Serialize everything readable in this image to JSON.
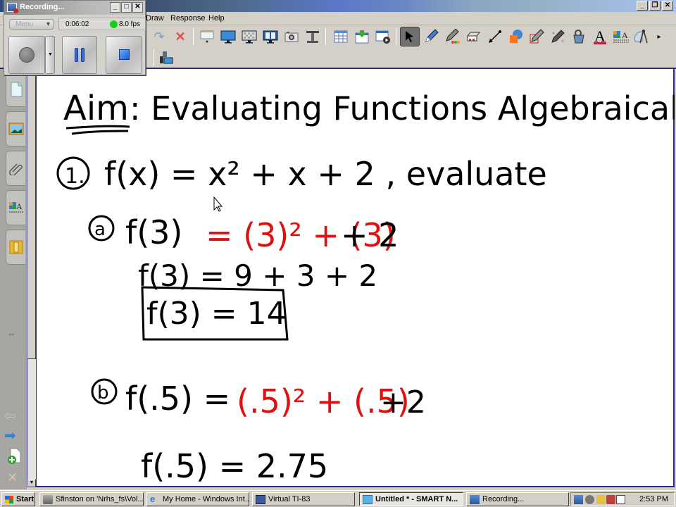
{
  "window": {
    "title_bar_controls": [
      "minimize",
      "restore",
      "close"
    ]
  },
  "menubar": {
    "items": [
      "Draw",
      "Response",
      "Help"
    ]
  },
  "toolbar": {
    "row1": [
      {
        "name": "redo-icon",
        "glyph": "↷"
      },
      {
        "name": "delete-icon",
        "glyph": "✕"
      },
      {
        "name": "screen-shade-icon",
        "glyph": "▭"
      },
      {
        "name": "full-screen-icon",
        "glyph": "🖵"
      },
      {
        "name": "transparent-background-icon",
        "glyph": "▦"
      },
      {
        "name": "dual-page-display-icon",
        "glyph": "▥"
      },
      {
        "name": "screen-capture-icon",
        "glyph": "📷"
      },
      {
        "name": "document-camera-icon",
        "glyph": "⊤"
      },
      {
        "name": "insert-table-icon",
        "glyph": "▤"
      },
      {
        "name": "insert-question-icon",
        "glyph": "⬇"
      },
      {
        "name": "start-assessment-icon",
        "glyph": "▶"
      },
      {
        "name": "select-arrow-icon",
        "glyph": "➤"
      },
      {
        "name": "pen-icon",
        "glyph": "✎"
      },
      {
        "name": "creative-pen-icon",
        "glyph": "✎"
      },
      {
        "name": "eraser-icon",
        "glyph": "▬"
      },
      {
        "name": "line-icon",
        "glyph": "╱"
      },
      {
        "name": "shapes-icon",
        "glyph": "◧"
      },
      {
        "name": "shape-recognition-pen-icon",
        "glyph": "✎"
      },
      {
        "name": "magic-pen-icon",
        "glyph": "✎"
      },
      {
        "name": "fill-icon",
        "glyph": "⛾"
      },
      {
        "name": "text-icon",
        "glyph": "A"
      },
      {
        "name": "properties-icon",
        "glyph": "A"
      },
      {
        "name": "measurement-tools-icon",
        "glyph": "⚖"
      },
      {
        "name": "more-tools-icon",
        "glyph": "▸"
      }
    ],
    "row2": [
      {
        "name": "customize-toolbar-icon",
        "glyph": "⚙"
      }
    ]
  },
  "recorder": {
    "title": "Recording...",
    "menu_label": "Menu",
    "elapsed": "0:06:02",
    "fps": "8.0 fps",
    "status_color": "#18d018",
    "buttons": [
      "record",
      "record-options",
      "pause",
      "stop"
    ]
  },
  "sidebar": {
    "tabs": [
      {
        "name": "page-sorter-tab",
        "label": "Page Sorter"
      },
      {
        "name": "gallery-tab",
        "label": "Gallery"
      },
      {
        "name": "attachments-tab",
        "label": "Attachments"
      },
      {
        "name": "properties-tab",
        "label": "Properties"
      },
      {
        "name": "add-ons-tab",
        "label": "Add-ons"
      }
    ],
    "bottom_controls": [
      "move-sidebar",
      "previous-page",
      "next-page",
      "add-page",
      "delete-page"
    ]
  },
  "notebook": {
    "title_line": {
      "prefix": "Aim",
      "text": ": Evaluating Functions Algebraically"
    },
    "problem": {
      "number": "1.",
      "expression": "f(x) = x² + x + 2 , evaluate"
    },
    "part_a": {
      "label": "a",
      "line1_black": "f(3)",
      "line1_red": "= (3)² + (3)",
      "line1_tail": "+ 2",
      "line2": "f(3) = 9 + 3 + 2",
      "answer": "f(3) = 14"
    },
    "part_b": {
      "label": "b",
      "line1_black": "f(.5) =",
      "line1_red": "(.5)² + (.5)",
      "line1_tail": "+2",
      "line2": "f(.5) = 2.75"
    },
    "ink_colors": {
      "black": "#000000",
      "red": "#e01010"
    }
  },
  "taskbar": {
    "start_label": "Start",
    "tasks": [
      {
        "label": "Sfinston on 'Nrhs_fs\\Vol...",
        "active": false
      },
      {
        "label": "My Home - Windows Int...",
        "active": false
      },
      {
        "label": "Virtual TI-83",
        "active": false
      },
      {
        "label": "Untitled * - SMART N...",
        "active": true
      },
      {
        "label": "Recording...",
        "active": false
      }
    ],
    "clock": "2:53 PM"
  }
}
